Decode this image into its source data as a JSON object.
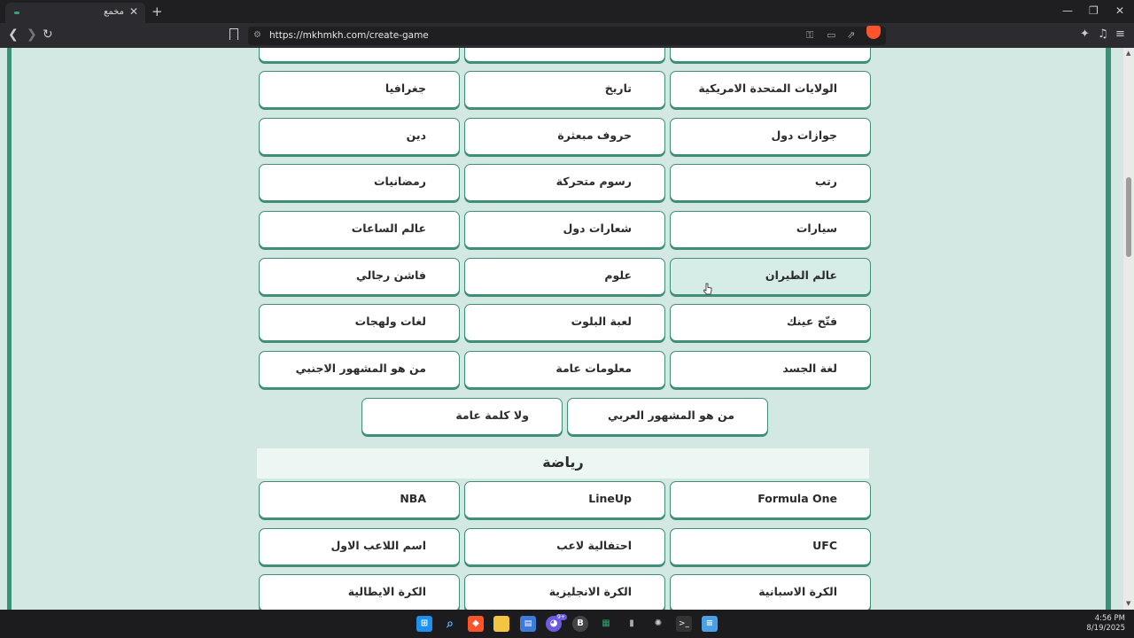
{
  "browser": {
    "tab_title": "مخمع",
    "url": "https://mkhmkh.com/create-game"
  },
  "categories_top": [
    [
      "الولايات المتحدة الامريكية",
      "تاريخ",
      "جغرافيا"
    ],
    [
      "جوازات دول",
      "حروف مبعثرة",
      "دين"
    ],
    [
      "رتب",
      "رسوم متحركة",
      "رمضانيات"
    ],
    [
      "سيارات",
      "شعارات دول",
      "عالم الساعات"
    ],
    [
      "عالم الطيران",
      "علوم",
      "فاشن رجالي"
    ],
    [
      "فتّح عينك",
      "لعبة البلوت",
      "لغات ولهجات"
    ],
    [
      "لغة الجسد",
      "معلومات عامة",
      "من هو المشهور الاجنبي"
    ],
    [
      "من هو المشهور العربي",
      "ولا كلمة عامة"
    ]
  ],
  "section_sports": {
    "title": "رياضة",
    "categories": [
      [
        "Formula One",
        "LineUp",
        "NBA"
      ],
      [
        "UFC",
        "احتفالية لاعب",
        "اسم اللاعب الاول"
      ],
      [
        "الكرة الاسبانية",
        "الكرة الانجليزية",
        "الكرة الايطالية"
      ]
    ]
  },
  "taskbar": {
    "time": "4:56 PM",
    "date": "8/19/2025",
    "discord_badge": "9+"
  }
}
